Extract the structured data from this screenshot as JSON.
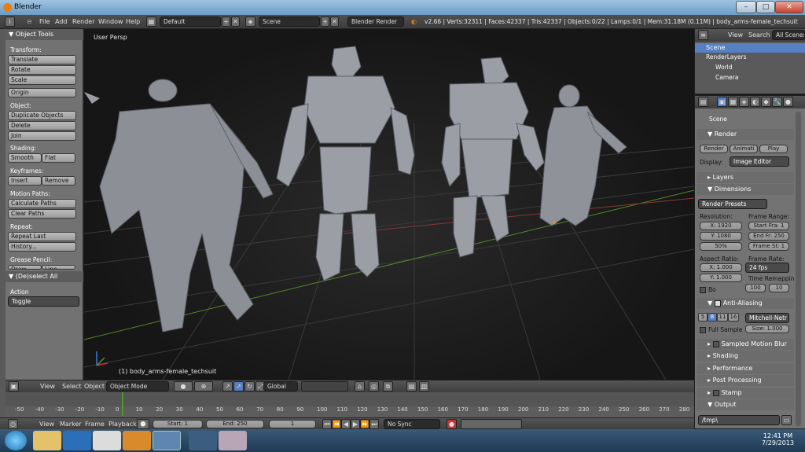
{
  "window": {
    "title": "Blender"
  },
  "menubar": {
    "menus": [
      "File",
      "Add",
      "Render",
      "Window",
      "Help"
    ],
    "screen_layout": "Default",
    "scene": "Scene",
    "render_engine": "Blender Render",
    "stats": "v2.66 | Verts:32311 | Faces:42337 | Tris:42337 | Objects:0/22 | Lamps:0/1 | Mem:31.18M (0.11M) | body_arms-female_techsuit"
  },
  "toolshelf": {
    "title": "Object Tools",
    "transform_label": "Transform:",
    "translate": "Translate",
    "rotate": "Rotate",
    "scale": "Scale",
    "origin": "Origin",
    "object_label": "Object:",
    "duplicate": "Duplicate Objects",
    "delete": "Delete",
    "join": "Join",
    "shading_label": "Shading:",
    "smooth": "Smooth",
    "flat": "Flat",
    "keyframes_label": "Keyframes:",
    "insert": "Insert",
    "remove": "Remove",
    "motion_label": "Motion Paths:",
    "calc_paths": "Calculate Paths",
    "clear_paths": "Clear Paths",
    "repeat_label": "Repeat:",
    "repeat_last": "Repeat Last",
    "history": "History...",
    "grease_label": "Grease Pencil:",
    "draw": "Draw",
    "line": "Line",
    "operator_title": "(De)select All",
    "action_label": "Action",
    "action_value": "Toggle"
  },
  "viewport": {
    "view_name": "User Persp",
    "object_info": "(1) body_arms-female_techsuit"
  },
  "view3d_header": {
    "menus": [
      "View",
      "Select",
      "Object"
    ],
    "mode": "Object Mode",
    "orientation": "Global"
  },
  "timeline": {
    "ticks": [
      "-50",
      "-40",
      "-30",
      "-20",
      "-10",
      "0",
      "10",
      "20",
      "30",
      "40",
      "50",
      "60",
      "70",
      "80",
      "90",
      "100",
      "110",
      "120",
      "130",
      "140",
      "150",
      "160",
      "170",
      "180",
      "190",
      "200",
      "210",
      "220",
      "230",
      "240",
      "250",
      "260",
      "270",
      "280"
    ],
    "menus": [
      "View",
      "Marker",
      "Frame",
      "Playback"
    ],
    "start": "Start: 1",
    "end": "End: 250",
    "current": "1",
    "sync": "No Sync"
  },
  "outliner": {
    "menus": [
      "View",
      "Search"
    ],
    "filter": "All Scenes",
    "items": [
      "Scene",
      "RenderLayers",
      "World",
      "Camera"
    ]
  },
  "properties": {
    "context": "Scene",
    "render_panel": "Render",
    "render_btn": "Render",
    "anim_btn": "Animati",
    "play_btn": "Play",
    "display_label": "Display:",
    "display_value": "Image Editor",
    "layers_panel": "Layers",
    "dimensions_panel": "Dimensions",
    "render_presets": "Render Presets",
    "resolution_label": "Resolution:",
    "res_x": "X: 1920",
    "res_y": "Y: 1080",
    "res_pct": "50%",
    "frame_range_label": "Frame Range:",
    "start_frame": "Start Fra: 1",
    "end_frame": "End Fr: 250",
    "frame_step": "Frame St: 1",
    "aspect_label": "Aspect Ratio:",
    "aspect_x": "X: 1.000",
    "aspect_y": "Y: 1.000",
    "frame_rate_label": "Frame Rate:",
    "fps": "24 fps",
    "time_remap_label": "Time Remappin",
    "remap_old": "100",
    "remap_new": "10",
    "bo_label": "Bo",
    "aa_panel": "Anti-Aliasing",
    "aa_samples": [
      "5",
      "8",
      "11",
      "16"
    ],
    "aa_filter": "Mitchell-Netr",
    "full_sample": "Full Sample",
    "aa_size": "Size: 1.000",
    "motion_blur_panel": "Sampled Motion Blur",
    "shading_panel": "Shading",
    "performance_panel": "Performance",
    "post_panel": "Post Processing",
    "stamp_panel": "Stamp",
    "output_panel": "Output",
    "output_path": "/tmp\\"
  },
  "taskbar": {
    "time": "12:41 PM",
    "date": "7/29/2013"
  },
  "colors": {
    "accent": "#5680c2",
    "grid_x": "#9a3a3a",
    "grid_y": "#4a8a2a"
  }
}
